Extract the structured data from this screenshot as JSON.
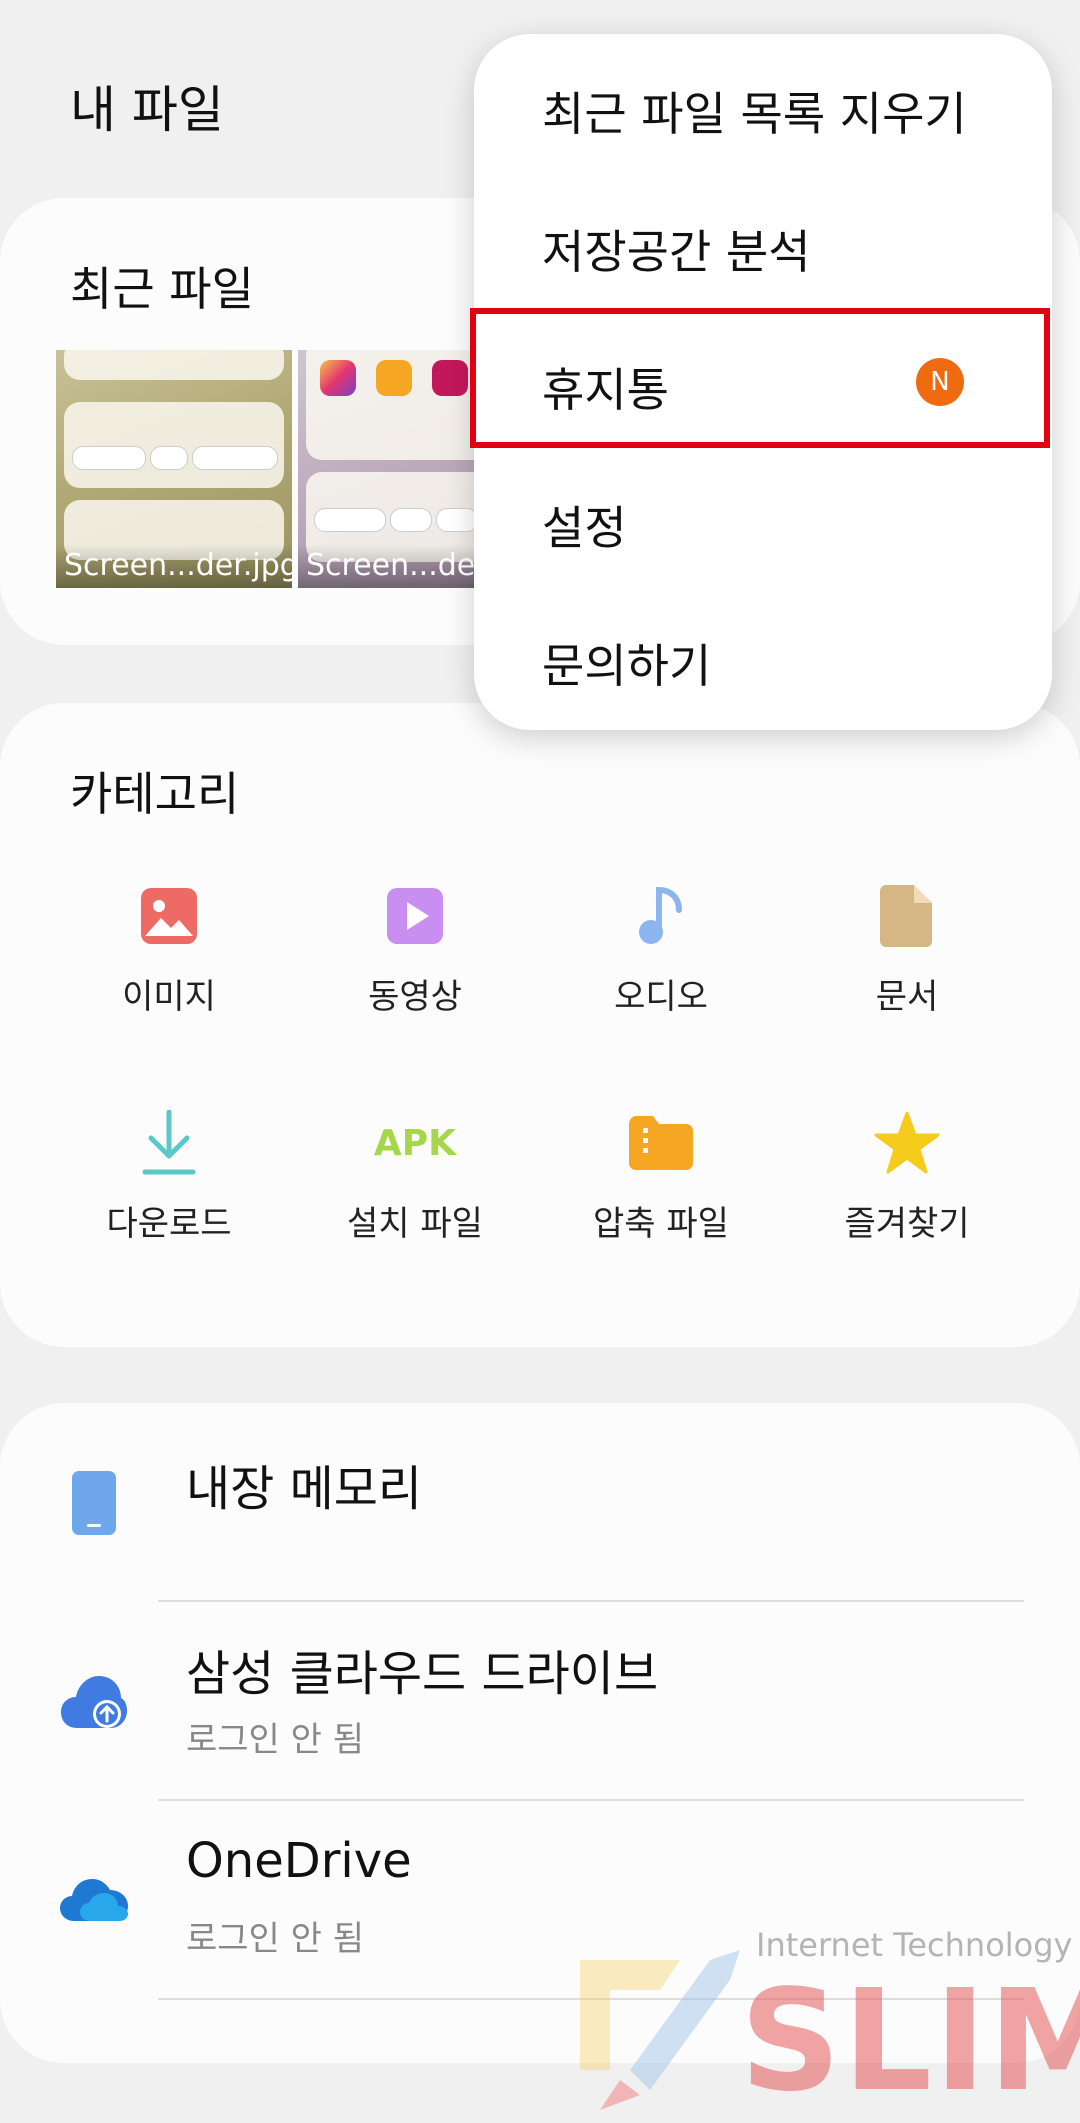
{
  "header": {
    "title": "내 파일"
  },
  "recent": {
    "title": "최근 파일",
    "files": [
      {
        "name": "Screen...der.jpg"
      },
      {
        "name": "Screen...der."
      }
    ]
  },
  "categories": {
    "title": "카테고리",
    "items": [
      {
        "label": "이미지",
        "icon": "image-icon",
        "color": "#ee6b65"
      },
      {
        "label": "동영상",
        "icon": "video-icon",
        "color": "#c98ff0"
      },
      {
        "label": "오디오",
        "icon": "audio-icon",
        "color": "#8cb4f0"
      },
      {
        "label": "문서",
        "icon": "document-icon",
        "color": "#d6b685"
      },
      {
        "label": "다운로드",
        "icon": "download-icon",
        "color": "#5bc8c8"
      },
      {
        "label": "설치 파일",
        "icon": "apk-icon",
        "color": "#a6d64a",
        "icon_text": "APK"
      },
      {
        "label": "압축 파일",
        "icon": "archive-icon",
        "color": "#f5a623"
      },
      {
        "label": "즐겨찾기",
        "icon": "star-icon",
        "color": "#f5cc1b"
      }
    ]
  },
  "storage": {
    "items": [
      {
        "name": "내장 메모리",
        "sub": "",
        "icon": "phone-icon",
        "color": "#6fa7ec"
      },
      {
        "name": "삼성 클라우드 드라이브",
        "sub": "로그인 안 됨",
        "icon": "cloud-upload-icon",
        "color": "#3f7be0"
      },
      {
        "name": "OneDrive",
        "sub": "로그인 안 됨",
        "icon": "onedrive-icon",
        "color": "#1f78d1"
      }
    ]
  },
  "menu": {
    "items": [
      {
        "label": "최근 파일 목록 지우기"
      },
      {
        "label": "저장공간 분석"
      },
      {
        "label": "휴지통",
        "badge": "N",
        "highlighted": true
      },
      {
        "label": "설정"
      },
      {
        "label": "문의하기"
      }
    ]
  },
  "watermark": {
    "line1": "Internet Technology",
    "line2": "SLIM"
  }
}
